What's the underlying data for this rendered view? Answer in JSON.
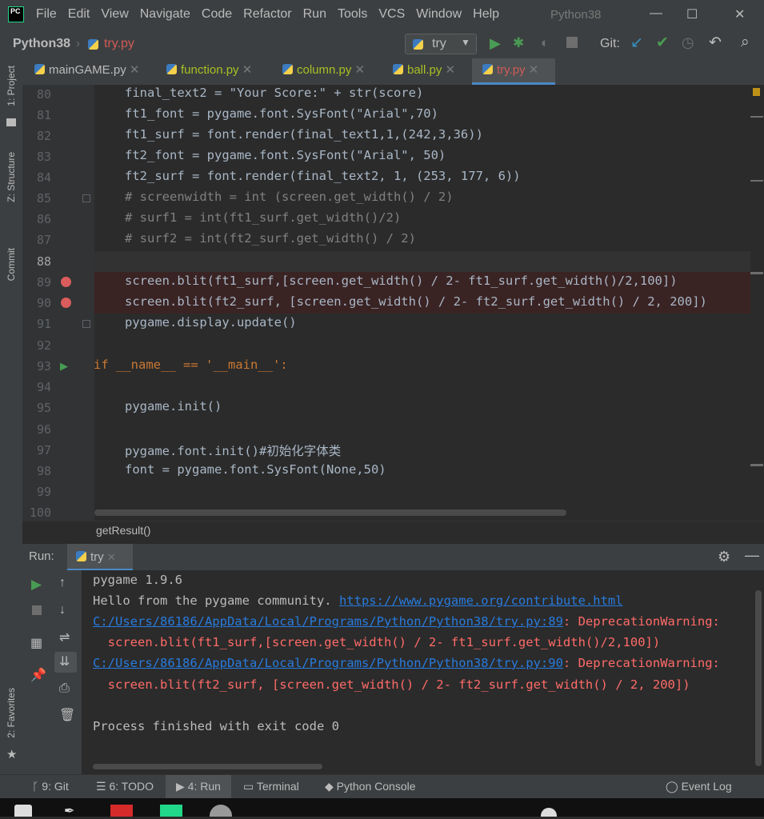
{
  "titlebar": {
    "logo": "PC",
    "menu": [
      "File",
      "Edit",
      "View",
      "Navigate",
      "Code",
      "Refactor",
      "Run",
      "Tools",
      "VCS",
      "Window",
      "Help"
    ],
    "project_title": "Python38",
    "min": "—",
    "max": "☐",
    "close": "✕"
  },
  "navbar": {
    "project": "Python38",
    "file": "try.py",
    "run_config": "try",
    "git_label": "Git:"
  },
  "tabs": [
    {
      "label": "mainGAME.py"
    },
    {
      "label": "function.py"
    },
    {
      "label": "column.py"
    },
    {
      "label": "ball.py"
    },
    {
      "label": "try.py"
    }
  ],
  "left_tools": {
    "project": "1: Project",
    "structure": "Z: Structure",
    "commit": "Commit",
    "favorites": "2: Favorites"
  },
  "editor": {
    "lines": [
      {
        "n": "80",
        "t": "final_text2 = \"Your Score:\" + str(score)"
      },
      {
        "n": "81",
        "t": "ft1_font = pygame.font.SysFont(\"Arial\",70)"
      },
      {
        "n": "82",
        "t": "ft1_surf = font.render(final_text1,1,(242,3,36))"
      },
      {
        "n": "83",
        "t": "ft2_font = pygame.font.SysFont(\"Arial\", 50)"
      },
      {
        "n": "84",
        "t": "ft2_surf = font.render(final_text2, 1, (253, 177, 6))"
      },
      {
        "n": "85",
        "t": "# screenwidth = int (screen.get_width() / 2)"
      },
      {
        "n": "86",
        "t": "# surf1 = int(ft1_surf.get_width()/2)"
      },
      {
        "n": "87",
        "t": "# surf2 = int(ft2_surf.get_width() / 2)"
      },
      {
        "n": "88",
        "t": ""
      },
      {
        "n": "89",
        "t": "screen.blit(ft1_surf,[screen.get_width() / 2- ft1_surf.get_width()/2,100])"
      },
      {
        "n": "90",
        "t": "screen.blit(ft2_surf, [screen.get_width() / 2- ft2_surf.get_width() / 2, 200])"
      },
      {
        "n": "91",
        "t": "pygame.display.update()"
      },
      {
        "n": "92",
        "t": ""
      },
      {
        "n": "93",
        "t": "if __name__ == '__main__':"
      },
      {
        "n": "94",
        "t": ""
      },
      {
        "n": "95",
        "t": "pygame.init()"
      },
      {
        "n": "96",
        "t": ""
      },
      {
        "n": "97",
        "t": "pygame.font.init()#初始化字体类"
      },
      {
        "n": "98",
        "t": "font = pygame.font.SysFont(None,50)"
      },
      {
        "n": "99",
        "t": ""
      },
      {
        "n": "100",
        "t": ""
      }
    ],
    "breadcrumb": "getResult()"
  },
  "run": {
    "label": "Run:",
    "tab": "try",
    "output": [
      {
        "t": "pygame 1.9.6",
        "c": "#bbbbbb"
      },
      {
        "t": "Hello from the pygame community. ",
        "link": "https://www.pygame.org/contribute.html",
        "c": "#bbbbbb"
      },
      {
        "link": "C:/Users/86186/AppData/Local/Programs/Python/Python38/try.py:89",
        "t": ": DeprecationWarning: ",
        "c": "#ff6b68"
      },
      {
        "t": "  screen.blit(ft1_surf,[screen.get_width() / 2- ft1_surf.get_width()/2,100])",
        "c": "#ff6b68"
      },
      {
        "link": "C:/Users/86186/AppData/Local/Programs/Python/Python38/try.py:90",
        "t": ": DeprecationWarning: ",
        "c": "#ff6b68"
      },
      {
        "t": "  screen.blit(ft2_surf, [screen.get_width() / 2- ft2_surf.get_width() / 2, 200])",
        "c": "#ff6b68"
      },
      {
        "t": "",
        "c": "#bbbbbb"
      },
      {
        "t": "Process finished with exit code 0",
        "c": "#bbbbbb"
      }
    ]
  },
  "statusbar": {
    "git": "9: Git",
    "todo": "6: TODO",
    "run": "4: Run",
    "terminal": "Terminal",
    "console": "Python Console",
    "eventlog": "Event Log"
  },
  "colors": {
    "accent_run": "#499c54",
    "breakpoint": "#db5c5c",
    "link": "#287bde"
  }
}
